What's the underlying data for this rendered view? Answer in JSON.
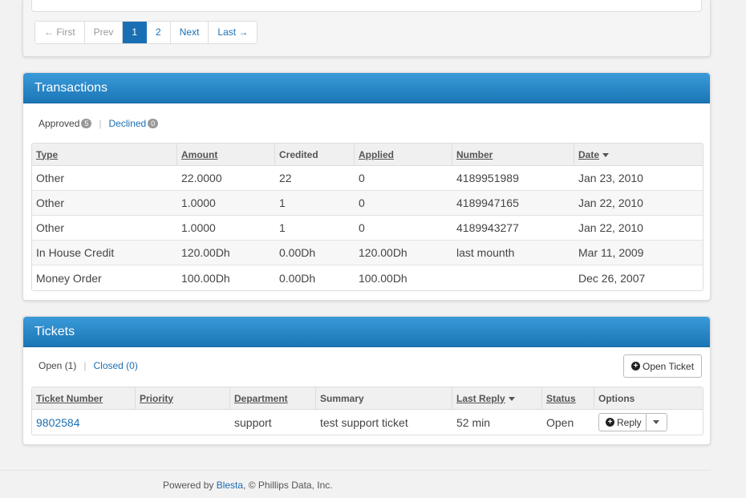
{
  "pagination": {
    "first": "← First",
    "prev": "Prev",
    "pages": [
      "1",
      "2"
    ],
    "current": "1",
    "next": "Next",
    "last": "Last →"
  },
  "transactions": {
    "title": "Transactions",
    "filters": {
      "approved_label": "Approved",
      "approved_count": "5",
      "declined_label": "Declined",
      "declined_count": "0"
    },
    "columns": {
      "type": "Type",
      "amount": "Amount",
      "credited": "Credited",
      "applied": "Applied",
      "number": "Number",
      "date": "Date"
    },
    "rows": [
      {
        "type": "Other",
        "amount": "22.0000",
        "credited": "22",
        "applied": "0",
        "number": "4189951989",
        "date": "Jan 23, 2010"
      },
      {
        "type": "Other",
        "amount": "1.0000",
        "credited": "1",
        "applied": "0",
        "number": "4189947165",
        "date": "Jan 22, 2010"
      },
      {
        "type": "Other",
        "amount": "1.0000",
        "credited": "1",
        "applied": "0",
        "number": "4189943277",
        "date": "Jan 22, 2010"
      },
      {
        "type": "In House Credit",
        "amount": "120.00Dh",
        "credited": "0.00Dh",
        "applied": "120.00Dh",
        "number": "last mounth",
        "date": "Mar 11, 2009"
      },
      {
        "type": "Money Order",
        "amount": "100.00Dh",
        "credited": "0.00Dh",
        "applied": "100.00Dh",
        "number": "",
        "date": "Dec 26, 2007"
      }
    ]
  },
  "tickets": {
    "title": "Tickets",
    "filters": {
      "open_label": "Open (1)",
      "closed_label": "Closed (0)"
    },
    "open_ticket_button": "Open Ticket",
    "columns": {
      "ticket_number": "Ticket Number",
      "priority": "Priority",
      "department": "Department",
      "summary": "Summary",
      "last_reply": "Last Reply",
      "status": "Status",
      "options": "Options"
    },
    "rows": [
      {
        "ticket_number": "9802584",
        "priority": "",
        "department": "support",
        "summary": "test support ticket",
        "last_reply": "52 min",
        "status": "Open",
        "reply_label": "Reply"
      }
    ]
  },
  "footer": {
    "prefix": "Powered by ",
    "link": "Blesta",
    "suffix": ", © Phillips Data, Inc."
  },
  "colors": {
    "accent": "#1a6fb4",
    "header_top": "#3a9ad9",
    "header_bottom": "#1b76b6"
  }
}
